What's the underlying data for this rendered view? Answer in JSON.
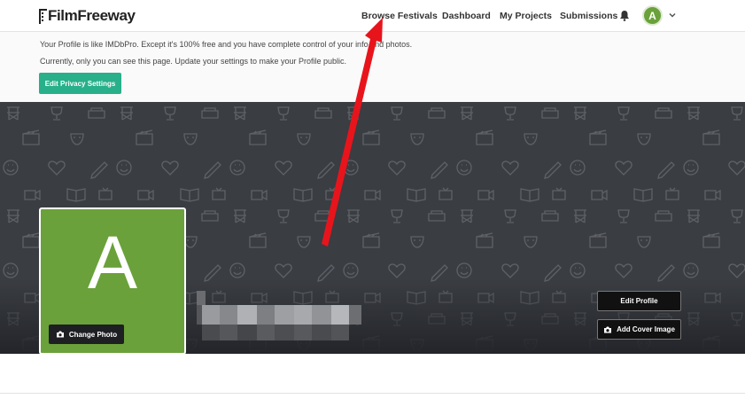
{
  "brand": {
    "name": "FilmFreeway"
  },
  "nav": {
    "items": [
      {
        "label": "Browse Festivals"
      },
      {
        "label": "Dashboard"
      },
      {
        "label": "My Projects"
      },
      {
        "label": "Submissions"
      }
    ],
    "bell_icon": "bell-icon",
    "avatar_initial": "A",
    "caret_icon": "chevron-down-icon"
  },
  "notice": {
    "line1": "Your Profile is like IMDbPro. Except it's 100% free and you have complete control of your info and photos.",
    "line2": "Currently, only you can see this page. Update your settings to make your Profile public.",
    "button_label": "Edit Privacy Settings"
  },
  "profile": {
    "initial": "A",
    "change_photo_label": "Change Photo",
    "edit_profile_label": "Edit Profile",
    "add_cover_label": "Add Cover Image"
  },
  "colors": {
    "accent_green": "#27b08a",
    "avatar_green": "#6aa13a",
    "cover_bg": "#3a3d42",
    "annotation_red": "#e8141c"
  }
}
